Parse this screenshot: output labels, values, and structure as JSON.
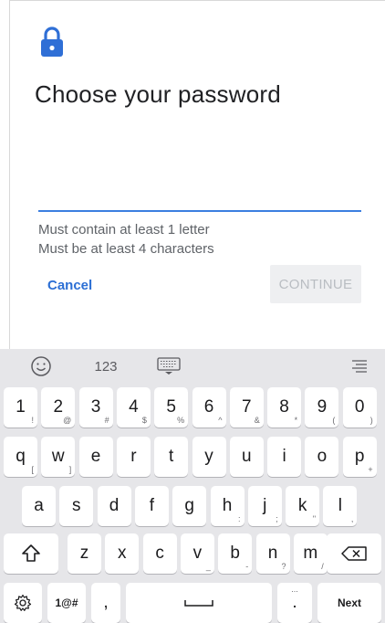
{
  "dialog": {
    "title": "Choose your password",
    "password_value": "",
    "rules": [
      "Must contain at least 1 letter",
      "Must be at least 4 characters"
    ],
    "cancel_label": "Cancel",
    "continue_label": "CONTINUE"
  },
  "keyboard": {
    "toolbar": {
      "numbers_label": "123"
    },
    "row1": [
      {
        "main": "1",
        "sub": "!"
      },
      {
        "main": "2",
        "sub": "@"
      },
      {
        "main": "3",
        "sub": "#"
      },
      {
        "main": "4",
        "sub": "$"
      },
      {
        "main": "5",
        "sub": "%"
      },
      {
        "main": "6",
        "sub": "^"
      },
      {
        "main": "7",
        "sub": "&"
      },
      {
        "main": "8",
        "sub": "*"
      },
      {
        "main": "9",
        "sub": "("
      },
      {
        "main": "0",
        "sub": ")"
      }
    ],
    "row2": [
      {
        "main": "q",
        "sub": "["
      },
      {
        "main": "w",
        "sub": "]"
      },
      {
        "main": "e",
        "sub": ""
      },
      {
        "main": "r",
        "sub": ""
      },
      {
        "main": "t",
        "sub": ""
      },
      {
        "main": "y",
        "sub": ""
      },
      {
        "main": "u",
        "sub": ""
      },
      {
        "main": "i",
        "sub": ""
      },
      {
        "main": "o",
        "sub": ""
      },
      {
        "main": "p",
        "sub": "+"
      }
    ],
    "row3": [
      {
        "main": "a",
        "sub": ""
      },
      {
        "main": "s",
        "sub": ""
      },
      {
        "main": "d",
        "sub": ""
      },
      {
        "main": "f",
        "sub": ""
      },
      {
        "main": "g",
        "sub": ""
      },
      {
        "main": "h",
        "sub": ":"
      },
      {
        "main": "j",
        "sub": ";"
      },
      {
        "main": "k",
        "sub": "\""
      },
      {
        "main": "l",
        "sub": ","
      }
    ],
    "row4": [
      {
        "main": "z",
        "sub": ""
      },
      {
        "main": "x",
        "sub": ""
      },
      {
        "main": "c",
        "sub": ""
      },
      {
        "main": "v",
        "sub": "_"
      },
      {
        "main": "b",
        "sub": "-"
      },
      {
        "main": "n",
        "sub": "?"
      },
      {
        "main": "m",
        "sub": "/"
      }
    ],
    "symbols_label": "1@#",
    "comma_label": ",",
    "period_label": ".",
    "period_sub": "...",
    "next_label": "Next"
  },
  "colors": {
    "accent": "#2c6fd4",
    "underline": "#3c7fe0",
    "keyboard_bg": "#e6e6e9"
  },
  "icons": [
    "lock-icon",
    "emoji-icon",
    "keyboard-icon",
    "menu-icon",
    "shift-icon",
    "backspace-icon",
    "settings-icon",
    "space-icon"
  ]
}
